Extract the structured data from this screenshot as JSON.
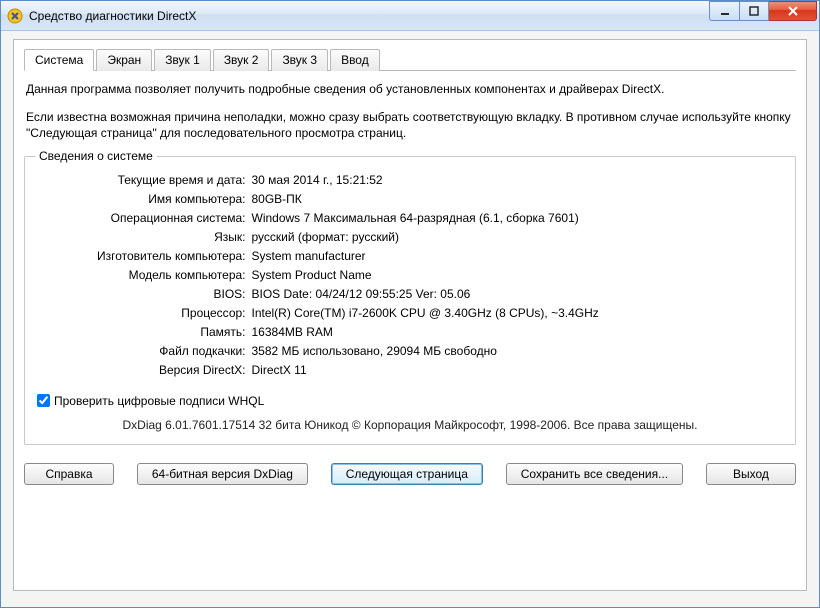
{
  "window": {
    "title": "Средство диагностики DirectX"
  },
  "tabs": {
    "system": "Система",
    "screen": "Экран",
    "sound1": "Звук 1",
    "sound2": "Звук 2",
    "sound3": "Звук 3",
    "input": "Ввод"
  },
  "intro": {
    "p1": "Данная программа позволяет получить подробные сведения об установленных компонентах и драйверах DirectX.",
    "p2": "Если известна возможная причина неполадки, можно сразу выбрать соответствующую вкладку. В противном случае используйте кнопку \"Следующая страница\" для последовательного просмотра страниц."
  },
  "group": {
    "title": "Сведения о системе",
    "rows": {
      "datetime_lbl": "Текущие время и дата:",
      "datetime_val": "30 мая 2014 г., 15:21:52",
      "pcname_lbl": "Имя компьютера:",
      "pcname_val": "80GB-ПК",
      "os_lbl": "Операционная система:",
      "os_val": "Windows 7 Максимальная 64-разрядная (6.1, сборка 7601)",
      "lang_lbl": "Язык:",
      "lang_val": "русский (формат: русский)",
      "mfr_lbl": "Изготовитель компьютера:",
      "mfr_val": "System manufacturer",
      "model_lbl": "Модель компьютера:",
      "model_val": "System Product Name",
      "bios_lbl": "BIOS:",
      "bios_val": "BIOS Date: 04/24/12 09:55:25 Ver: 05.06",
      "cpu_lbl": "Процессор:",
      "cpu_val": "Intel(R) Core(TM) i7-2600K CPU @ 3.40GHz (8 CPUs), ~3.4GHz",
      "mem_lbl": "Память:",
      "mem_val": "16384MB RAM",
      "page_lbl": "Файл подкачки:",
      "page_val": "3582 МБ использовано, 29094 МБ свободно",
      "dx_lbl": "Версия DirectX:",
      "dx_val": "DirectX 11"
    },
    "whql_label": "Проверить цифровые подписи WHQL",
    "whql_checked": true
  },
  "footer": "DxDiag 6.01.7601.17514 32 бита Юникод   © Корпорация Майкрософт, 1998-2006.  Все права защищены.",
  "buttons": {
    "help": "Справка",
    "bit64": "64-битная версия DxDiag",
    "next": "Следующая страница",
    "save": "Сохранить все сведения...",
    "exit": "Выход"
  }
}
